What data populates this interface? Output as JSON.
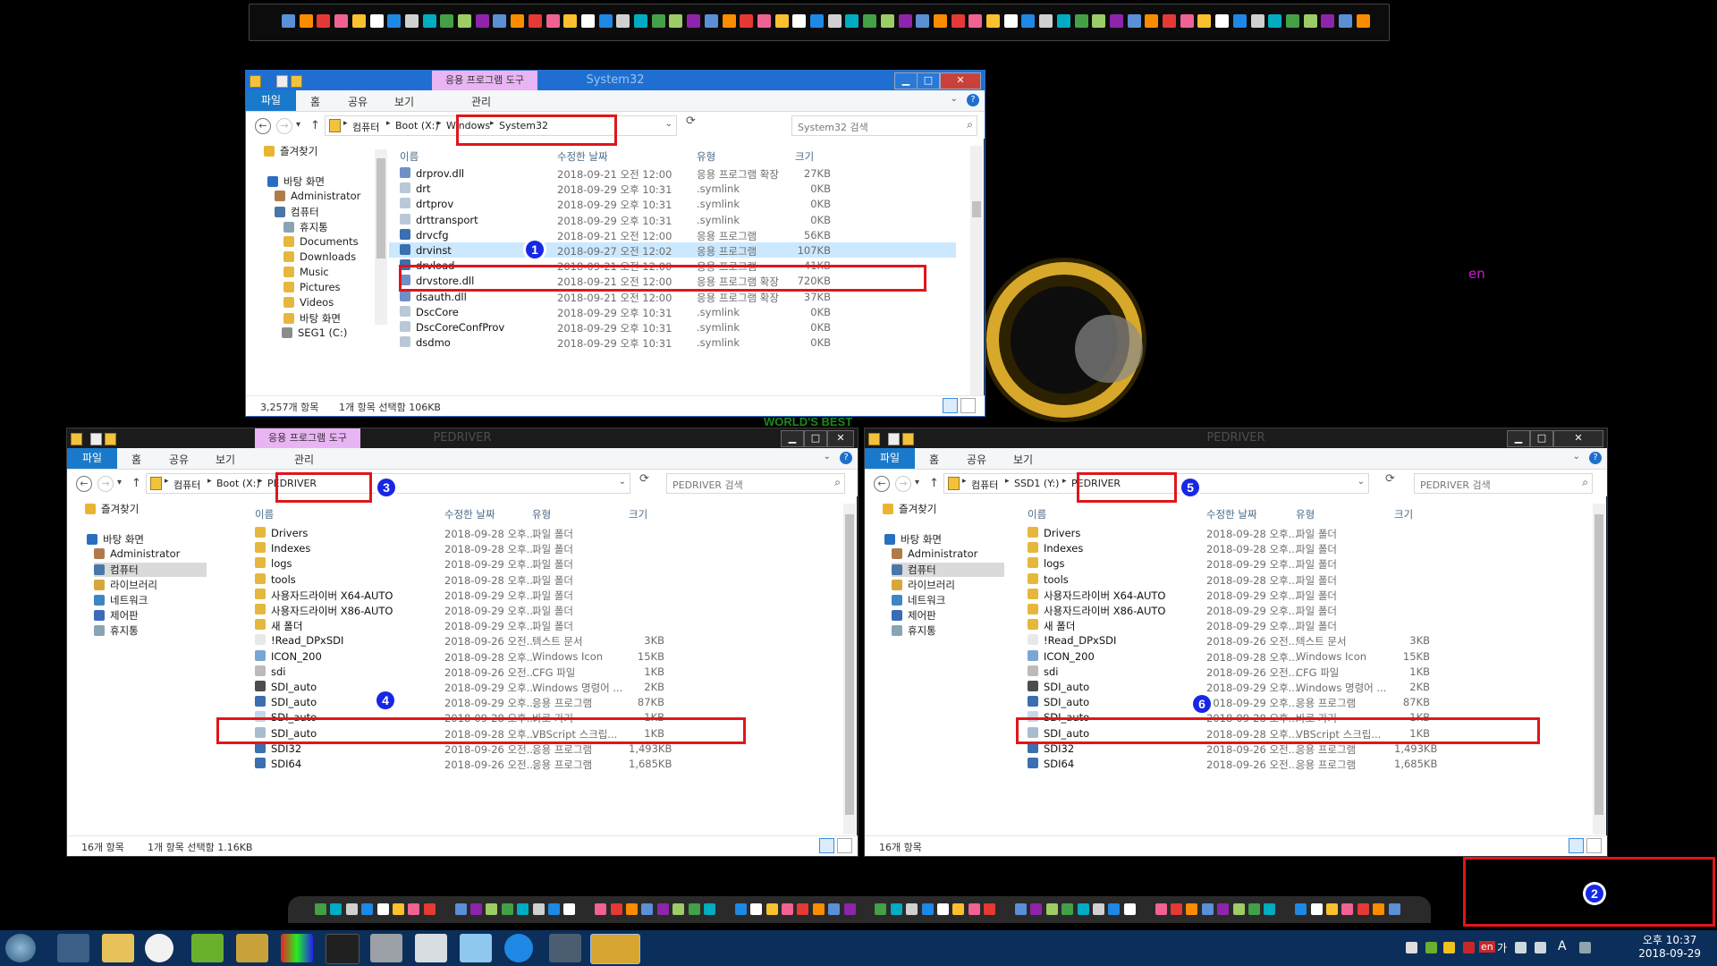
{
  "colors": {
    "titlebar_active": "#1f6fd2",
    "selection": "#cce8ff",
    "highlight": "#e0161a",
    "badge": "#1727e6",
    "taskbar": "#0b2f5a",
    "context_tab": "#e9b4f3"
  },
  "desktop": {
    "lang_label": "en",
    "wallpaper_caption": "WORLD'S BEST"
  },
  "ribbon_labels": {
    "file": "파일",
    "home": "홈",
    "share": "공유",
    "view": "보기",
    "manage": "관리",
    "app_tools": "응용 프로그램 도구"
  },
  "nav_common": {
    "back": "←",
    "forward": "→",
    "recent": "▾",
    "up": "↑",
    "refresh": "⟳",
    "sep": "▸",
    "dropdown": "⌄",
    "search_icon": "⌕",
    "help": "?",
    "minimize": "▁",
    "maximize": "□",
    "close": "✕"
  },
  "columns": {
    "name": "이름",
    "date": "수정한 날짜",
    "type": "유형",
    "size": "크기"
  },
  "win1": {
    "title": "System32",
    "address": [
      "컴퓨터",
      "Boot (X:)",
      "Windows",
      "System32"
    ],
    "search_placeholder": "System32 검색",
    "nav": [
      {
        "label": "즐겨찾기",
        "icon": "star-icon"
      },
      {
        "label": "바탕 화면",
        "icon": "desktop-icon"
      },
      {
        "label": "Administrator",
        "icon": "user-icon"
      },
      {
        "label": "컴퓨터",
        "icon": "computer-icon"
      },
      {
        "label": "휴지통",
        "icon": "recycle-bin-icon"
      },
      {
        "label": "Documents",
        "icon": "folder-icon"
      },
      {
        "label": "Downloads",
        "icon": "folder-icon"
      },
      {
        "label": "Music",
        "icon": "folder-icon"
      },
      {
        "label": "Pictures",
        "icon": "folder-icon"
      },
      {
        "label": "Videos",
        "icon": "folder-icon"
      },
      {
        "label": "바탕 화면",
        "icon": "folder-icon"
      },
      {
        "label": "SEG1 (C:)",
        "icon": "drive-icon"
      }
    ],
    "files": [
      {
        "name": "drprov.dll",
        "date": "2018-09-21 오전 12:00",
        "type": "응용 프로그램 확장",
        "size": "27KB",
        "icon": "dll-icon"
      },
      {
        "name": "drt",
        "date": "2018-09-29 오후 10:31",
        "type": ".symlink",
        "size": "0KB",
        "icon": "symlink-icon"
      },
      {
        "name": "drtprov",
        "date": "2018-09-29 오후 10:31",
        "type": ".symlink",
        "size": "0KB",
        "icon": "symlink-icon"
      },
      {
        "name": "drttransport",
        "date": "2018-09-29 오후 10:31",
        "type": ".symlink",
        "size": "0KB",
        "icon": "symlink-icon"
      },
      {
        "name": "drvcfg",
        "date": "2018-09-21 오전 12:00",
        "type": "응용 프로그램",
        "size": "56KB",
        "icon": "exe-icon"
      },
      {
        "name": "drvinst",
        "date": "2018-09-27 오전 12:02",
        "type": "응용 프로그램",
        "size": "107KB",
        "icon": "exe-icon"
      },
      {
        "name": "drvload",
        "date": "2018-09-21 오전 12:00",
        "type": "응용 프로그램",
        "size": "41KB",
        "icon": "exe-icon"
      },
      {
        "name": "drvstore.dll",
        "date": "2018-09-21 오전 12:00",
        "type": "응용 프로그램 확장",
        "size": "720KB",
        "icon": "dll-icon"
      },
      {
        "name": "dsauth.dll",
        "date": "2018-09-21 오전 12:00",
        "type": "응용 프로그램 확장",
        "size": "37KB",
        "icon": "dll-icon"
      },
      {
        "name": "DscCore",
        "date": "2018-09-29 오후 10:31",
        "type": ".symlink",
        "size": "0KB",
        "icon": "symlink-icon"
      },
      {
        "name": "DscCoreConfProv",
        "date": "2018-09-29 오후 10:31",
        "type": ".symlink",
        "size": "0KB",
        "icon": "symlink-icon"
      },
      {
        "name": "dsdmo",
        "date": "2018-09-29 오후 10:31",
        "type": ".symlink",
        "size": "0KB",
        "icon": "symlink-icon"
      }
    ],
    "status_count": "3,257개 항목",
    "status_selected": "1개 항목 선택함 106KB"
  },
  "win2": {
    "title": "PEDRIVER",
    "address": [
      "컴퓨터",
      "Boot (X:)",
      "PEDRIVER"
    ],
    "search_placeholder": "PEDRIVER 검색",
    "nav": [
      {
        "label": "즐겨찾기",
        "icon": "star-icon"
      },
      {
        "label": "바탕 화면",
        "icon": "desktop-icon"
      },
      {
        "label": "Administrator",
        "icon": "user-icon"
      },
      {
        "label": "컴퓨터",
        "icon": "computer-icon"
      },
      {
        "label": "라이브러리",
        "icon": "library-icon"
      },
      {
        "label": "네트워크",
        "icon": "network-icon"
      },
      {
        "label": "제어판",
        "icon": "control-panel-icon"
      },
      {
        "label": "휴지통",
        "icon": "recycle-bin-icon"
      }
    ],
    "files": [
      {
        "name": "Drivers",
        "date": "2018-09-28 오후...",
        "type": "파일 폴더",
        "size": "",
        "icon": "folder-icon"
      },
      {
        "name": "Indexes",
        "date": "2018-09-28 오후...",
        "type": "파일 폴더",
        "size": "",
        "icon": "folder-icon"
      },
      {
        "name": "logs",
        "date": "2018-09-29 오후...",
        "type": "파일 폴더",
        "size": "",
        "icon": "folder-icon"
      },
      {
        "name": "tools",
        "date": "2018-09-28 오후...",
        "type": "파일 폴더",
        "size": "",
        "icon": "folder-icon"
      },
      {
        "name": "사용자드라이버 X64-AUTO",
        "date": "2018-09-29 오후...",
        "type": "파일 폴더",
        "size": "",
        "icon": "folder-icon"
      },
      {
        "name": "사용자드라이버 X86-AUTO",
        "date": "2018-09-29 오후...",
        "type": "파일 폴더",
        "size": "",
        "icon": "folder-icon"
      },
      {
        "name": "새 폴더",
        "date": "2018-09-29 오후...",
        "type": "파일 폴더",
        "size": "",
        "icon": "folder-icon"
      },
      {
        "name": "!Read_DPxSDI",
        "date": "2018-09-26 오전...",
        "type": "텍스트 문서",
        "size": "3KB",
        "icon": "text-file-icon"
      },
      {
        "name": "ICON_200",
        "date": "2018-09-28 오후...",
        "type": "Windows Icon",
        "size": "15KB",
        "icon": "ico-file-icon"
      },
      {
        "name": "sdi",
        "date": "2018-09-26 오전...",
        "type": "CFG 파일",
        "size": "1KB",
        "icon": "cfg-file-icon"
      },
      {
        "name": "SDI_auto",
        "date": "2018-09-29 오후...",
        "type": "Windows 명령어 ...",
        "size": "2KB",
        "icon": "cmd-file-icon"
      },
      {
        "name": "SDI_auto",
        "date": "2018-09-29 오후...",
        "type": "응용 프로그램",
        "size": "87KB",
        "icon": "exe-icon"
      },
      {
        "name": "SDI_auto",
        "date": "2018-09-28 오후...",
        "type": "바로 가기",
        "size": "1KB",
        "icon": "shortcut-icon"
      },
      {
        "name": "SDI_auto",
        "date": "2018-09-28 오후...",
        "type": "VBScript 스크립...",
        "size": "1KB",
        "icon": "vbs-file-icon"
      },
      {
        "name": "SDI32",
        "date": "2018-09-26 오전...",
        "type": "응용 프로그램",
        "size": "1,493KB",
        "icon": "exe-icon"
      },
      {
        "name": "SDI64",
        "date": "2018-09-26 오전...",
        "type": "응용 프로그램",
        "size": "1,685KB",
        "icon": "exe-icon"
      }
    ],
    "status_count": "16개 항목",
    "status_selected": "1개 항목 선택함 1.16KB"
  },
  "win3": {
    "title": "PEDRIVER",
    "address": [
      "컴퓨터",
      "SSD1 (Y:)",
      "PEDRIVER"
    ],
    "search_placeholder": "PEDRIVER 검색",
    "status_count": "16개 항목",
    "status_selected": ""
  },
  "badges": [
    "1",
    "2",
    "3",
    "4",
    "5",
    "6"
  ],
  "taskbar": {
    "clock_time": "오후 10:37",
    "clock_date": "2018-09-29",
    "tray_ime_a": "A",
    "tray_ime_ga": "가",
    "tray_lang": "en"
  }
}
